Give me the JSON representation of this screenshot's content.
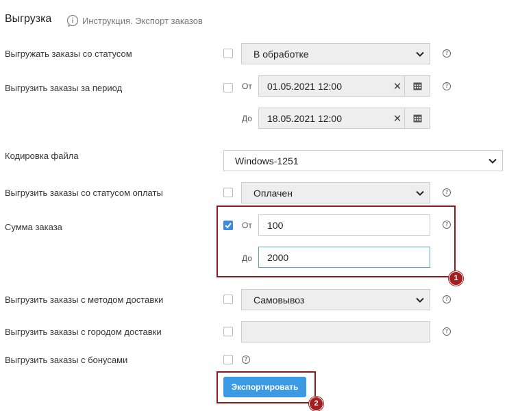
{
  "header": {
    "title": "Выгрузка",
    "instruction_link": "Инструкция. Экспорт заказов"
  },
  "rows": {
    "status": {
      "label": "Выгружать заказы со статусом",
      "value": "В обработке",
      "checked": false
    },
    "period": {
      "label": "Выгрузить заказы за период",
      "from_label": "От",
      "from_value": "01.05.2021 12:00",
      "to_label": "До",
      "to_value": "18.05.2021 12:00",
      "checked": false
    },
    "encoding": {
      "label": "Кодировка файла",
      "value": "Windows-1251"
    },
    "payment_status": {
      "label": "Выгрузить заказы со статусом оплаты",
      "value": "Оплачен",
      "checked": false
    },
    "order_sum": {
      "label": "Сумма заказа",
      "from_label": "От",
      "from_value": "100",
      "to_label": "До",
      "to_value": "2000",
      "checked": true
    },
    "delivery_method": {
      "label": "Выгрузить заказы с методом доставки",
      "value": "Самовывоз",
      "checked": false
    },
    "delivery_city": {
      "label": "Выгрузить заказы с городом доставки",
      "value": "",
      "checked": false
    },
    "bonuses": {
      "label": "Выгрузить заказы с бонусами",
      "checked": false
    }
  },
  "export_button": {
    "label": "Экспортировать"
  },
  "annotations": {
    "badge_1": "1",
    "badge_2": "2",
    "color": "#8b1a1a"
  },
  "help_glyph": "?",
  "colors": {
    "accent": "#3b9ae3",
    "checkbox_checked": "#3c8ad9"
  }
}
